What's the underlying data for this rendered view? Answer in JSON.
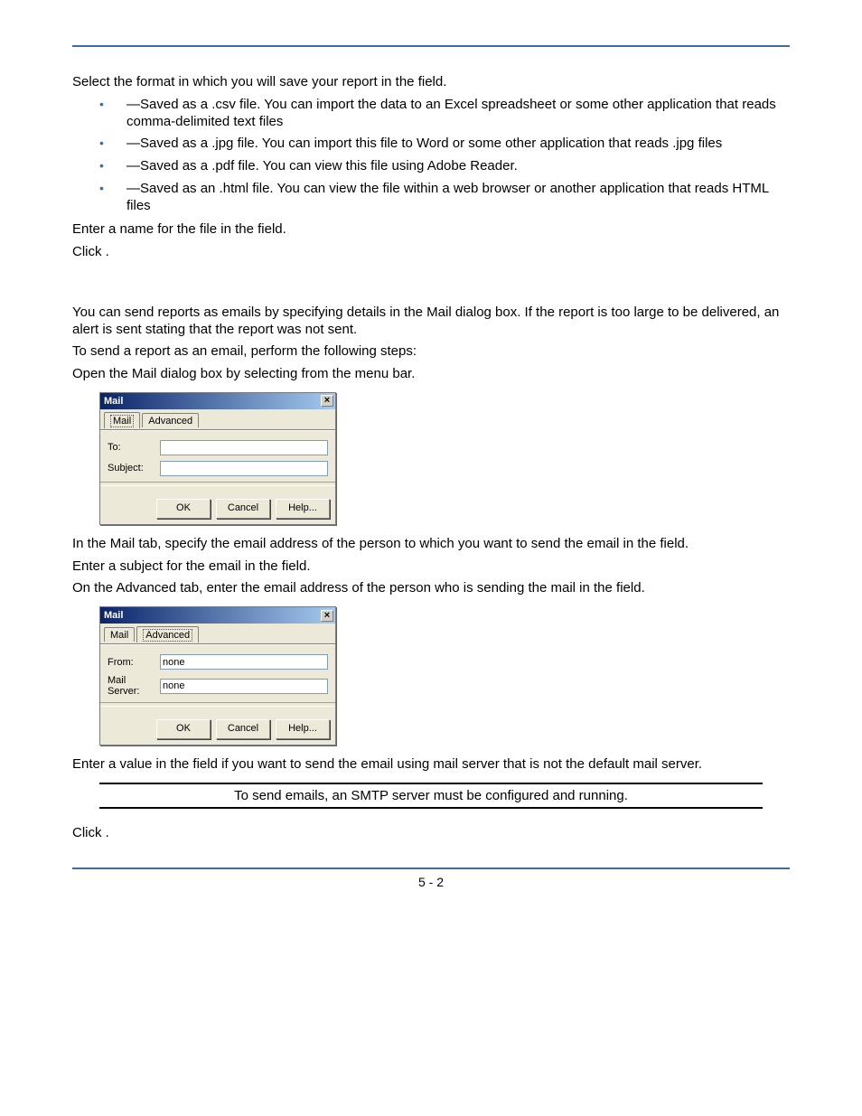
{
  "page": {
    "footer": "5 - 2"
  },
  "para": {
    "step2_pre": "Select the format in which you will save your report in the ",
    "step2_post": " field.",
    "step3_pre": "Enter a name for the file in the ",
    "step3_post": " field.",
    "step4_pre": "Click ",
    "step4_post": "."
  },
  "formats": [
    {
      "desc": "—Saved as a .csv file. You can import the data to an Excel spreadsheet or some other application that reads comma-delimited text files"
    },
    {
      "desc": "—Saved as a .jpg file. You can import this file to Word or some other application that reads .jpg files"
    },
    {
      "desc": "—Saved as a .pdf file. You can view this file using Adobe Reader."
    },
    {
      "desc": "—Saved as an .html file. You can view the file within a web browser or another application that reads HTML files"
    }
  ],
  "email": {
    "intro": "You can send reports as emails by specifying details in the Mail dialog box. If the report is too large to be delivered, an alert is sent stating that the report was not sent.",
    "to_send": "To send a report as an email, perform the following steps:",
    "step1_pre": "Open the Mail dialog box by selecting ",
    "step1_post": " from the menu bar.",
    "step2_pre": "In the Mail tab, specify the email address of the person to which you want to send the email in the ",
    "step2_post": " field.",
    "step3_pre": "Enter a subject for the email in the ",
    "step3_post": " field.",
    "step4_pre": "On the Advanced tab, enter the email address of the person who is sending the mail in the ",
    "step4_post": " field.",
    "step5_pre": "Enter a value in the ",
    "step5_post": " field if you want to send the email using mail server that is not the default mail server.",
    "step6_pre": "Click ",
    "step6_post": "."
  },
  "dialog1": {
    "title": "Mail",
    "tabs": {
      "mail": "Mail",
      "advanced": "Advanced"
    },
    "labels": {
      "to": "To:",
      "subject": "Subject:"
    },
    "values": {
      "to": "",
      "subject": ""
    },
    "buttons": {
      "ok": "OK",
      "cancel": "Cancel",
      "help": "Help..."
    }
  },
  "dialog2": {
    "title": "Mail",
    "tabs": {
      "mail": "Mail",
      "advanced": "Advanced"
    },
    "labels": {
      "from": "From:",
      "server": "Mail Server:"
    },
    "values": {
      "from": "none",
      "server": "none"
    },
    "buttons": {
      "ok": "OK",
      "cancel": "Cancel",
      "help": "Help..."
    }
  },
  "note": "To send emails, an SMTP server must be configured and running."
}
